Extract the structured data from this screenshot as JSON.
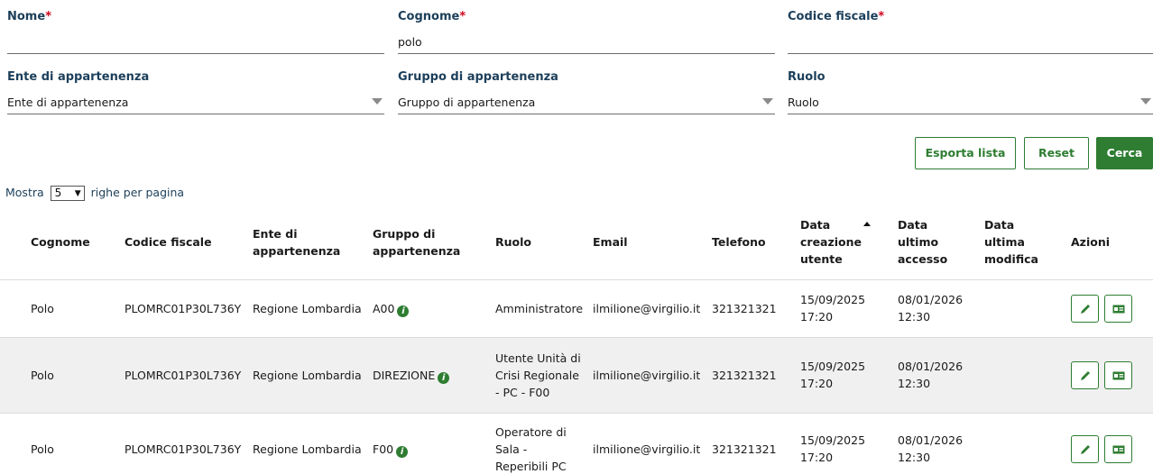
{
  "filters": {
    "nome": {
      "label": "Nome",
      "required_mark": "*",
      "value": ""
    },
    "cognome": {
      "label": "Cognome",
      "required_mark": "*",
      "value": "polo"
    },
    "codice_fiscale": {
      "label": "Codice fiscale",
      "required_mark": "*",
      "value": ""
    },
    "ente": {
      "label": "Ente di appartenenza",
      "selected": "Ente di appartenenza"
    },
    "gruppo": {
      "label": "Gruppo di appartenenza",
      "selected": "Gruppo di appartenenza"
    },
    "ruolo": {
      "label": "Ruolo",
      "selected": "Ruolo"
    }
  },
  "actions": {
    "export": "Esporta lista",
    "reset": "Reset",
    "search": "Cerca"
  },
  "pagination": {
    "prefix": "Mostra",
    "page_size": "5",
    "suffix": "righe per pagina"
  },
  "table": {
    "headers": {
      "cognome": "Cognome",
      "codice_fiscale": "Codice fiscale",
      "ente": "Ente di appartenenza",
      "gruppo": "Gruppo di appartenenza",
      "ruolo": "Ruolo",
      "email": "Email",
      "telefono": "Telefono",
      "data_creazione": "Data creazione utente",
      "data_accesso": "Data ultimo accesso",
      "data_modifica": "Data ultima modifica",
      "azioni": "Azioni"
    },
    "rows": [
      {
        "cognome": "Polo",
        "codice_fiscale": "PLOMRC01P30L736Y",
        "ente": "Regione Lombardia",
        "gruppo": "A00",
        "ruolo": "Amministratore",
        "email": "ilmilione@virgilio.it",
        "telefono": "321321321",
        "creazione_data": "15/09/2025",
        "creazione_ora": "17:20",
        "accesso_data": "08/01/2026",
        "accesso_ora": "12:30",
        "modifica": ""
      },
      {
        "cognome": "Polo",
        "codice_fiscale": "PLOMRC01P30L736Y",
        "ente": "Regione Lombardia",
        "gruppo": "DIREZIONE",
        "ruolo": "Utente Unità di Crisi Regionale - PC - F00",
        "email": "ilmilione@virgilio.it",
        "telefono": "321321321",
        "creazione_data": "15/09/2025",
        "creazione_ora": "17:20",
        "accesso_data": "08/01/2026",
        "accesso_ora": "12:30",
        "modifica": ""
      },
      {
        "cognome": "Polo",
        "codice_fiscale": "PLOMRC01P30L736Y",
        "ente": "Regione Lombardia",
        "gruppo": "F00",
        "ruolo": "Operatore di Sala - Reperibili PC",
        "email": "ilmilione@virgilio.it",
        "telefono": "321321321",
        "creazione_data": "15/09/2025",
        "creazione_ora": "17:20",
        "accesso_data": "08/01/2026",
        "accesso_ora": "12:30",
        "modifica": ""
      }
    ]
  },
  "icons": {
    "info": "info-icon",
    "sort": "sort-asc-icon",
    "edit": "pencil-icon",
    "detail": "id-card-icon",
    "dropdown": "caret-down-icon"
  },
  "colors": {
    "primary": "#2e7d32",
    "label": "#1c3f5a",
    "required": "#d0021b",
    "row_alt": "#f0f0f0"
  }
}
